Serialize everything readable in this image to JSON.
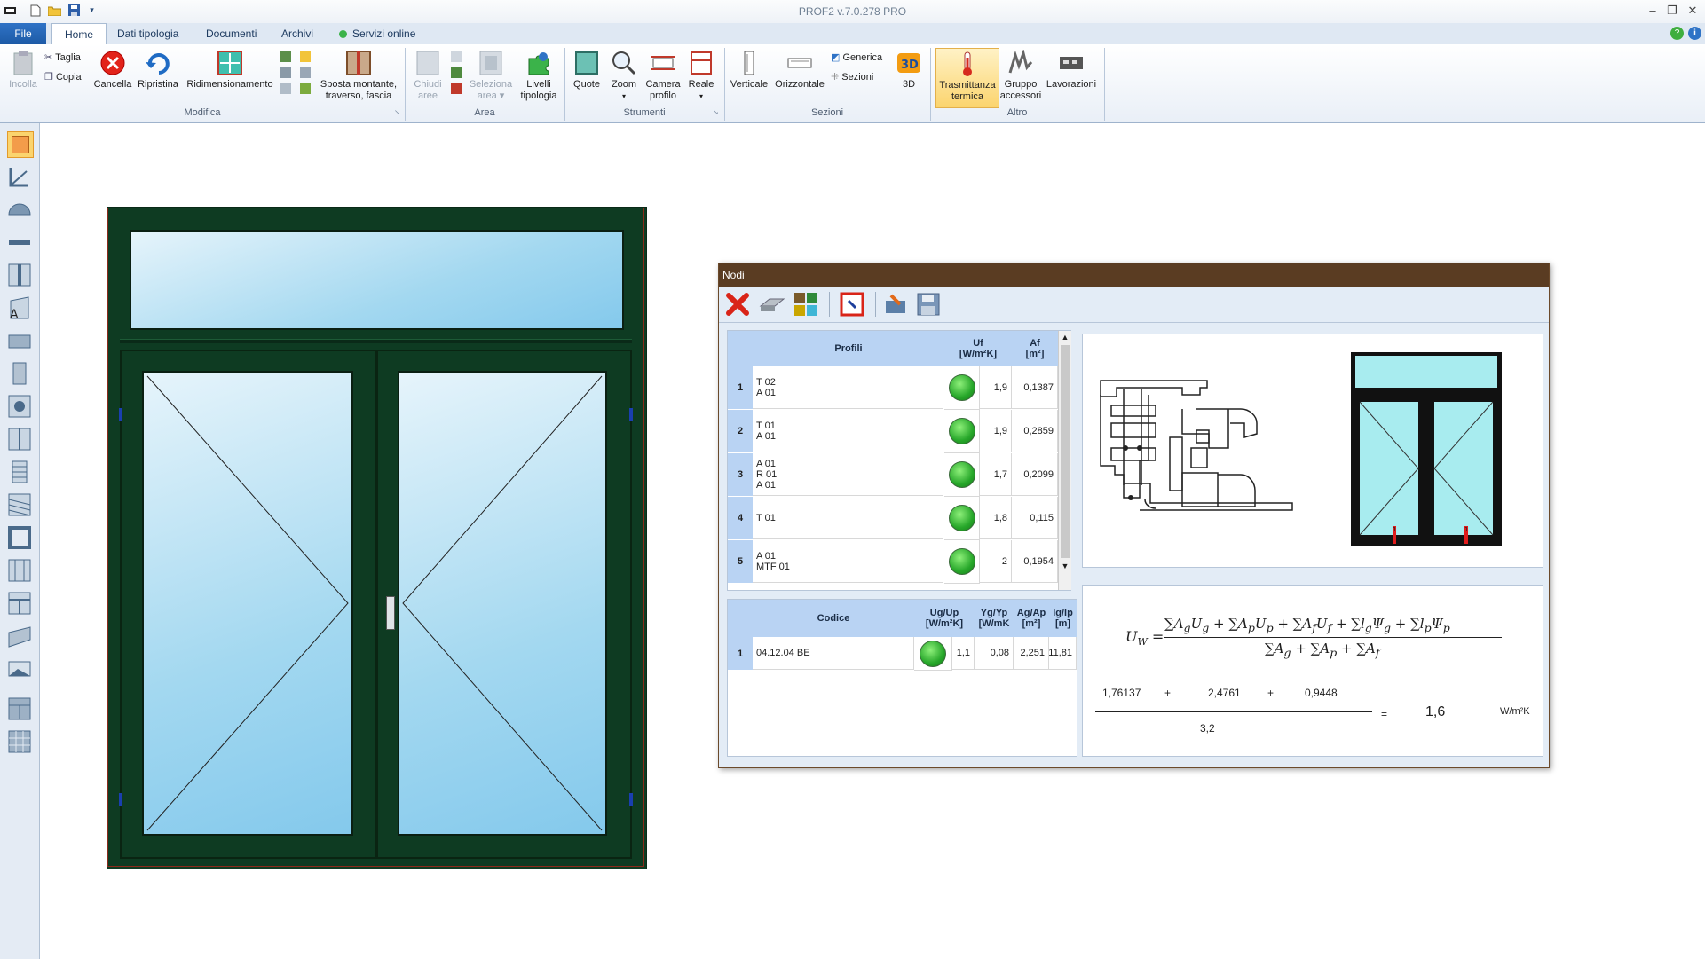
{
  "app": {
    "title": "PROF2  v.7.0.278  PRO"
  },
  "tabs": {
    "file": "File",
    "home": "Home",
    "dati": "Dati tipologia",
    "documenti": "Documenti",
    "archivi": "Archivi",
    "servizi": "Servizi online"
  },
  "ribbon": {
    "incolla": "Incolla",
    "taglia": "Taglia",
    "copia": "Copia",
    "cancella": "Cancella",
    "ripristina": "Ripristina",
    "ridimensionamento": "Ridimensionamento",
    "sposta1": "Sposta montante,",
    "sposta2": "traverso, fascia",
    "chiudi1": "Chiudi",
    "chiudi2": "aree",
    "seleziona1": "Seleziona",
    "seleziona2": "area",
    "livelli1": "Livelli",
    "livelli2": "tipologia",
    "quote": "Quote",
    "zoom": "Zoom",
    "camera1": "Camera",
    "camera2": "profilo",
    "reale": "Reale",
    "verticale": "Verticale",
    "orizzontale": "Orizzontale",
    "generica": "Generica",
    "sezioni_btn": "Sezioni",
    "tre_d": "3D",
    "trasm1": "Trasmittanza",
    "trasm2": "termica",
    "gruppo1": "Gruppo",
    "gruppo2": "accessori",
    "lavorazioni": "Lavorazioni",
    "groups": {
      "modifica": "Modifica",
      "area": "Area",
      "strumenti": "Strumenti",
      "sezioni": "Sezioni",
      "altro": "Altro"
    }
  },
  "dialog": {
    "title": "Nodi",
    "profili_table": {
      "headers": {
        "profili": "Profili",
        "uf1": "Uf",
        "uf2": "[W/m²K]",
        "af1": "Af",
        "af2": "[m²]"
      },
      "rows": [
        {
          "n": "1",
          "l1": "T 02",
          "l2": "A 01",
          "l3": "",
          "uf": "1,9",
          "af": "0,1387"
        },
        {
          "n": "2",
          "l1": "T 01",
          "l2": "A 01",
          "l3": "",
          "uf": "1,9",
          "af": "0,2859"
        },
        {
          "n": "3",
          "l1": "A 01",
          "l2": "R 01",
          "l3": "A 01",
          "uf": "1,7",
          "af": "0,2099"
        },
        {
          "n": "4",
          "l1": "T 01",
          "l2": "",
          "l3": "",
          "uf": "1,8",
          "af": "0,115"
        },
        {
          "n": "5",
          "l1": "A 01",
          "l2": "MTF 01",
          "l3": "",
          "uf": "2",
          "af": "0,1954"
        }
      ]
    },
    "codice_table": {
      "headers": {
        "codice": "Codice",
        "ug1": "Ug/Up",
        "ug2": "[W/m²K]",
        "yg1": "Yg/Yp",
        "yg2": "[W/mK",
        "ag1": "Ag/Ap",
        "ag2": "[m²]",
        "lg1": "lg/lp",
        "lg2": "[m]"
      },
      "rows": [
        {
          "n": "1",
          "codice": "04.12.04 BE",
          "ug": "1,1",
          "yg": "0,08",
          "ag": "2,251",
          "lg": "11,81"
        }
      ]
    },
    "formula": {
      "a": "1,76137",
      "plus1": "+",
      "b": "2,4761",
      "plus2": "+",
      "c": "0,9448",
      "den": "3,2",
      "eq": "=",
      "result": "1,6",
      "unit": "W/m²K"
    }
  },
  "colors": {
    "frame": "#0e3b22",
    "ribbon_active": "#fde39b",
    "dialog_caption": "#5a3c22"
  }
}
